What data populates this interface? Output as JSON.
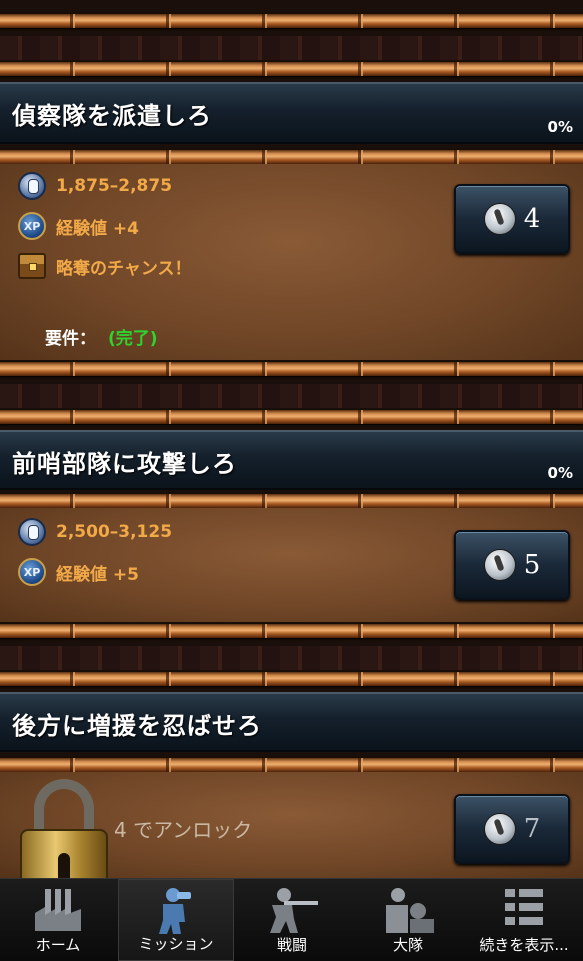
{
  "missions": [
    {
      "title": "偵察隊を派遣しろ",
      "progress": "0%",
      "rewards": [
        {
          "icon": "silver-coin-icon",
          "text": "1,875–2,875"
        },
        {
          "icon": "xp-icon",
          "text": "経験値 +4"
        },
        {
          "icon": "treasure-chest-icon",
          "text": "略奪のチャンス！"
        }
      ],
      "requirement_label": "要件：",
      "requirement_status": "(完了)",
      "button_icon": "energy-icon",
      "button_value": "4"
    },
    {
      "title": "前哨部隊に攻撃しろ",
      "progress": "0%",
      "rewards": [
        {
          "icon": "silver-coin-icon",
          "text": "2,500–3,125"
        },
        {
          "icon": "xp-icon",
          "text": "経験値 +5"
        }
      ],
      "button_icon": "energy-icon",
      "button_value": "5"
    },
    {
      "title": "後方に増援を忍ばせろ",
      "locked": true,
      "lock_icon": "padlock-icon",
      "unlock_text": "4 でアンロック",
      "button_icon": "energy-icon",
      "button_value": "7"
    }
  ],
  "nav": {
    "active": "ミッション",
    "tabs": [
      {
        "label": "ホーム",
        "icon": "factory-icon"
      },
      {
        "label": "ミッション",
        "icon": "soldier-binoculars-icon"
      },
      {
        "label": "戦闘",
        "icon": "soldier-rifle-icon"
      },
      {
        "label": "大隊",
        "icon": "soldiers-group-icon"
      },
      {
        "label": "続きを表示...",
        "icon": "list-icon"
      }
    ]
  },
  "colors": {
    "reward_text": "#f2a948",
    "complete_text": "#2ed42e",
    "header_bg": "#14202c",
    "card_bg": "#6e4526"
  }
}
